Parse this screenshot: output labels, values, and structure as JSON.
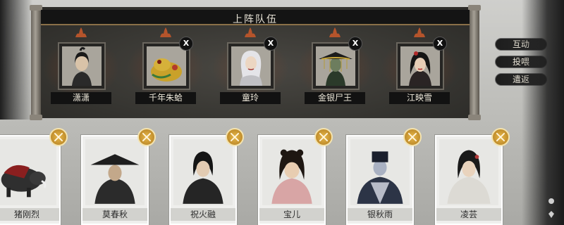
{
  "title": "上阵队伍",
  "team": [
    {
      "name": "潇潇",
      "removable": false
    },
    {
      "name": "千年朱蛤",
      "removable": true
    },
    {
      "name": "童玲",
      "removable": true
    },
    {
      "name": "金银尸王",
      "removable": true
    },
    {
      "name": "江映雪",
      "removable": true
    }
  ],
  "remove_label": "X",
  "menu": {
    "interact": "互动",
    "gift": "投喂",
    "back": "遣返"
  },
  "roster": [
    {
      "name": "猪刚烈"
    },
    {
      "name": "莫春秋"
    },
    {
      "name": "祝火融"
    },
    {
      "name": "宝儿"
    },
    {
      "name": "银秋雨"
    },
    {
      "name": "凌芸"
    }
  ],
  "colors": {
    "badge": "#d4a23a",
    "panel": "#34332f",
    "title_bar": "#141414"
  }
}
